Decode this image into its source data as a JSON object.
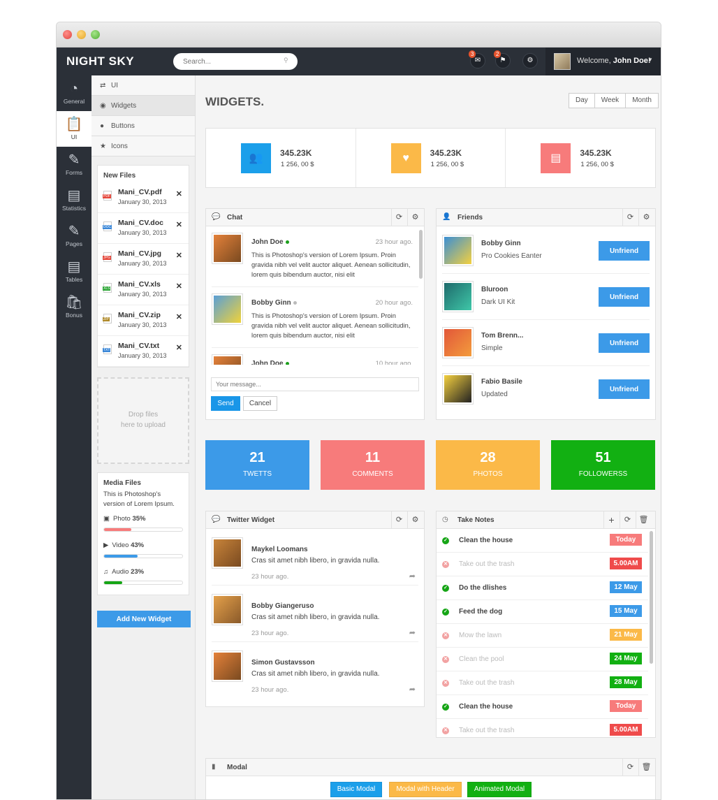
{
  "app": {
    "brand": "NIGHT SKY"
  },
  "search": {
    "placeholder": "Search..."
  },
  "topbar": {
    "messages_badge": "3",
    "flags_badge": "2",
    "welcome_prefix": "Welcome,",
    "user_name": "John Doe!"
  },
  "leftnav": {
    "items": [
      {
        "label": "General",
        "icon": "dashboard-icon"
      },
      {
        "label": "UI",
        "icon": "clipboard-icon"
      },
      {
        "label": "Forms",
        "icon": "document-edit-icon"
      },
      {
        "label": "Statistics",
        "icon": "bar-chart-icon"
      },
      {
        "label": "Pages",
        "icon": "pages-icon"
      },
      {
        "label": "Tables",
        "icon": "table-icon"
      },
      {
        "label": "Bonus",
        "icon": "bag-icon"
      }
    ]
  },
  "subnav": {
    "items": [
      {
        "label": "UI",
        "icon": "shuffle-icon"
      },
      {
        "label": "Widgets",
        "icon": "eye-slash-icon"
      },
      {
        "label": "Buttons",
        "icon": "drop-icon"
      },
      {
        "label": "Icons",
        "icon": "star-icon"
      }
    ]
  },
  "new_files": {
    "title": "New Files",
    "files": [
      {
        "name": "Mani_CV.pdf",
        "date": "January 30, 2013",
        "ext": "PDF",
        "color": "#e5473b"
      },
      {
        "name": "Mani_CV.doc",
        "date": "January 30, 2013",
        "ext": "DOC",
        "color": "#3c88d8"
      },
      {
        "name": "Mani_CV.jpg",
        "date": "January 30, 2013",
        "ext": "JPG",
        "color": "#e5473b"
      },
      {
        "name": "Mani_CV.xls",
        "date": "January 30, 2013",
        "ext": "XLS",
        "color": "#2aa534"
      },
      {
        "name": "Mani_CV.zip",
        "date": "January 30, 2013",
        "ext": "ZIP",
        "color": "#b08a2a"
      },
      {
        "name": "Mani_CV.txt",
        "date": "January 30, 2013",
        "ext": "TXT",
        "color": "#3c88d8"
      }
    ]
  },
  "dropzone": {
    "line1": "Drop files",
    "line2": "here to upload"
  },
  "media_files": {
    "title": "Media Files",
    "description": "This is Photoshop's version of Lorem Ipsum.",
    "items": [
      {
        "label": "Photo",
        "percent_text": "35%",
        "value": 0.35,
        "color": "#f77b7b",
        "icon": "image-icon"
      },
      {
        "label": "Video",
        "percent_text": "43%",
        "value": 0.43,
        "color": "#3c9ae8",
        "icon": "video-camera-icon"
      },
      {
        "label": "Audio",
        "percent_text": "23%",
        "value": 0.23,
        "color": "#15a515",
        "icon": "music-note-icon"
      }
    ]
  },
  "add_widget": {
    "label": "Add New Widget"
  },
  "page": {
    "title": "WIDGETS."
  },
  "range": {
    "options": [
      "Day",
      "Week",
      "Month"
    ]
  },
  "stats": [
    {
      "value": "345.23K",
      "sub": "1 256, 00 $",
      "color": "#1b9fea",
      "icon": "users-icon"
    },
    {
      "value": "345.23K",
      "sub": "1 256, 00 $",
      "color": "#fbb948",
      "icon": "heart-icon"
    },
    {
      "value": "345.23K",
      "sub": "1 256, 00 $",
      "color": "#f77b7b",
      "icon": "bar-chart-icon"
    }
  ],
  "chat": {
    "title": "Chat",
    "messages": [
      {
        "name": "John Doe",
        "time": "23 hour ago.",
        "status": "online",
        "text": "This is Photoshop's version of Lorem Ipsum. Proin gravida nibh vel velit auctor aliquet. Aenean sollicitudin, lorem quis bibendum auctor, nisi elit"
      },
      {
        "name": "Bobby Ginn",
        "time": "20 hour ago.",
        "status": "offline",
        "text": "This is Photoshop's version of Lorem Ipsum. Proin gravida nibh vel velit auctor aliquet. Aenean sollicitudin, lorem quis bibendum auctor, nisi elit"
      },
      {
        "name": "John Doe",
        "time": "10 hour ago.",
        "status": "online",
        "text": ""
      }
    ],
    "input_placeholder": "Your message...",
    "send_label": "Send",
    "cancel_label": "Cancel"
  },
  "friends": {
    "title": "Friends",
    "items": [
      {
        "name": "Bobby Ginn",
        "sub": "Pro Cookies Eanter",
        "button": "Unfriend"
      },
      {
        "name": "Bluroon",
        "sub": "Dark UI Kit",
        "button": "Unfriend"
      },
      {
        "name": "Tom Brenn...",
        "sub": "Simple",
        "button": "Unfriend"
      },
      {
        "name": "Fabio Basile",
        "sub": "Updated",
        "button": "Unfriend"
      }
    ]
  },
  "tiles": [
    {
      "number": "21",
      "label": "TWETTS",
      "color": "#3c9ae8"
    },
    {
      "number": "11",
      "label": "COMMENTS",
      "color": "#f77b7b"
    },
    {
      "number": "28",
      "label": "PHOTOS",
      "color": "#fbb948"
    },
    {
      "number": "51",
      "label": "FOLLOWERSS",
      "color": "#12b012"
    }
  ],
  "twitter": {
    "title": "Twitter Widget",
    "tweets": [
      {
        "name": "Maykel Loomans",
        "text": "Cras sit amet nibh libero, in gravida nulla.",
        "time": "23 hour ago."
      },
      {
        "name": "Bobby Giangeruso",
        "text": "Cras sit amet nibh libero, in gravida nulla.",
        "time": "23 hour ago."
      },
      {
        "name": "Simon Gustavsson",
        "text": "Cras sit amet nibh libero, in gravida nulla.",
        "time": "23 hour ago."
      }
    ]
  },
  "notes": {
    "title": "Take Notes",
    "items": [
      {
        "text": "Clean the house",
        "done": true,
        "tag": "Today",
        "tag_color": "#f77b7b"
      },
      {
        "text": "Take out the trash",
        "done": false,
        "tag": "5.00AM",
        "tag_color": "#ef4b4b"
      },
      {
        "text": "Do the dlishes",
        "done": true,
        "tag": "12 May",
        "tag_color": "#3c9ae8"
      },
      {
        "text": "Feed the dog",
        "done": true,
        "tag": "15 May",
        "tag_color": "#3c9ae8"
      },
      {
        "text": "Mow the lawn",
        "done": false,
        "tag": "21 May",
        "tag_color": "#fbb948"
      },
      {
        "text": "Clean the pool",
        "done": false,
        "tag": "24 May",
        "tag_color": "#12b012"
      },
      {
        "text": "Take out the trash",
        "done": false,
        "tag": "28 May",
        "tag_color": "#12b012"
      },
      {
        "text": "Clean the house",
        "done": true,
        "tag": "Today",
        "tag_color": "#f77b7b"
      },
      {
        "text": "Take out the trash",
        "done": false,
        "tag": "5.00AM",
        "tag_color": "#ef4b4b"
      }
    ]
  },
  "modal": {
    "title": "Modal",
    "buttons": [
      {
        "label": "Basic Modal",
        "color": "#1b9fea"
      },
      {
        "label": "Modal with Header",
        "color": "#fbb948"
      },
      {
        "label": "Animated Modal",
        "color": "#12b012"
      }
    ]
  }
}
